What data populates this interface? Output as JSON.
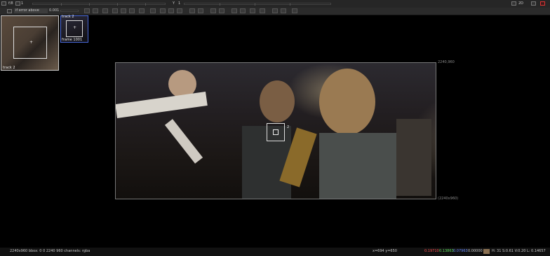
{
  "topbar": {
    "channel_value": "f/8",
    "frame_value": "1",
    "y_label": "Y",
    "y_value": "1",
    "view_mode": "2D"
  },
  "toolbar": {
    "blend_mode": "if error above",
    "gain_value": "0.001"
  },
  "thumbnails": [
    {
      "label": "track 2"
    },
    {
      "label": "track 2",
      "sublabel": "frame 1001"
    }
  ],
  "viewer": {
    "format_top": "2240,960",
    "format_bottom": "(2240x960)",
    "tracker_label": "2"
  },
  "statusbar": {
    "info": "2240x960  bbox: 0 0 2240 960 channels: rgba",
    "coords": "x=694 y=650",
    "r": "0.19710",
    "g": "0.13863",
    "b": "0.07963",
    "a": "0.00000",
    "hsvl": "H: 31 S:0.61 V:0.20  L: 0.14657",
    "colors": {
      "r": "#ff5050",
      "g": "#5fe05f",
      "b": "#6a8cff",
      "swatch": "#8a7052"
    }
  }
}
